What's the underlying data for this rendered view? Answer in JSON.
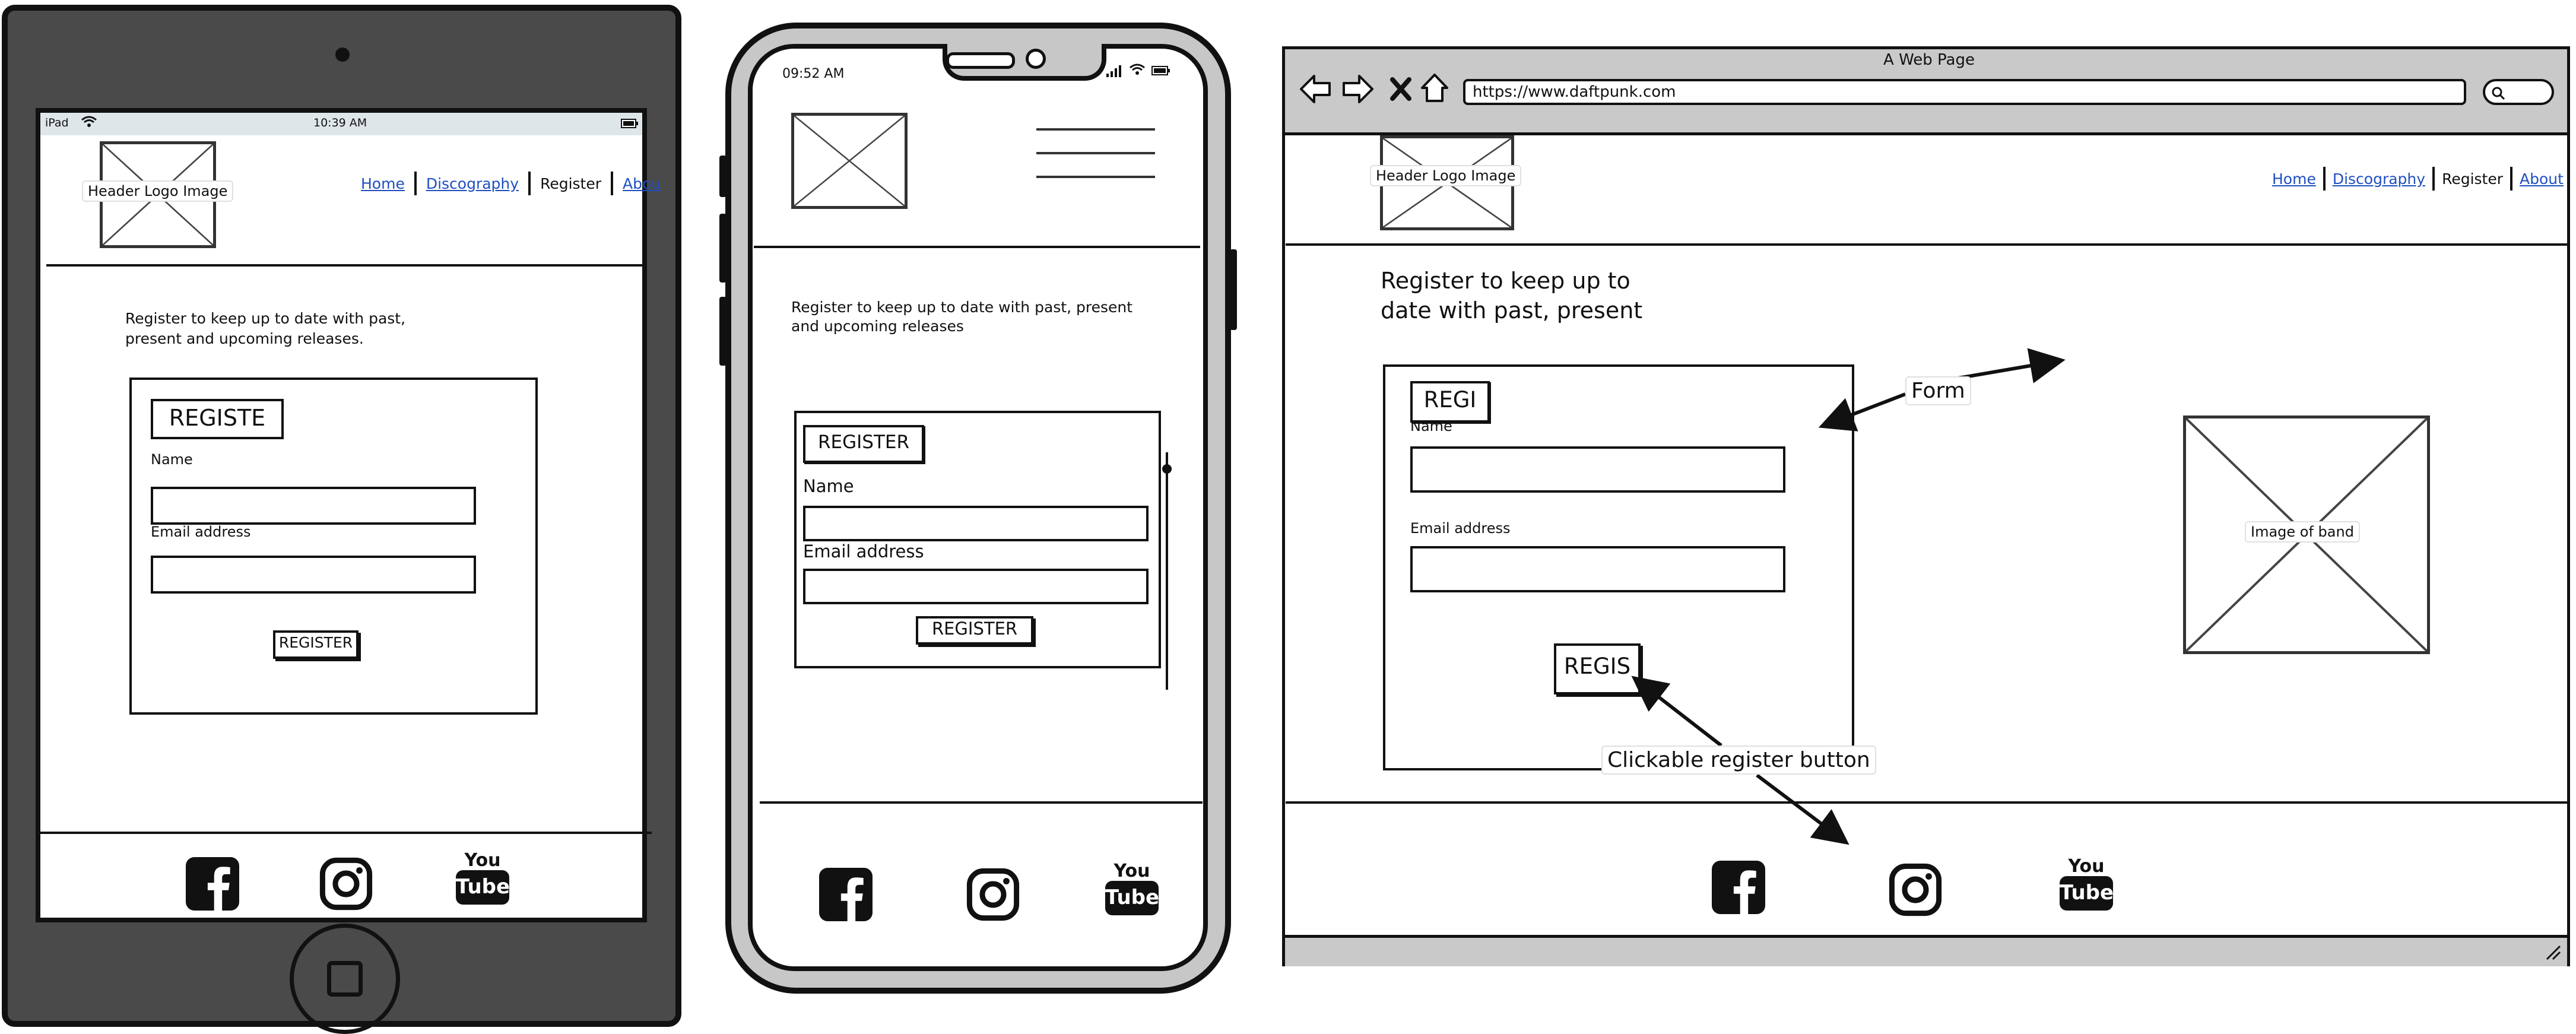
{
  "tablet": {
    "status": {
      "device": "iPad",
      "time": "10:39 AM"
    },
    "logo_label": "Header Logo Image",
    "nav": [
      "Home",
      "Discography",
      "Register",
      "Abou"
    ],
    "intro": [
      "Register to keep up to date with past,",
      "present and upcoming releases."
    ],
    "form_title": "REGISTE",
    "name_label": "Name",
    "email_label": "Email address",
    "submit": "REGISTER"
  },
  "phone": {
    "status": {
      "time": "09:52 AM"
    },
    "intro": [
      "Register to keep up to date with past, present",
      "and upcoming releases"
    ],
    "form_title": "REGISTER",
    "name_label": "Name",
    "email_label": "Email address",
    "submit": "REGISTER"
  },
  "desktop": {
    "window_title": "A Web Page",
    "url": "https://www.daftpunk.com",
    "logo_label": "Header Logo Image",
    "nav": [
      "Home",
      "Discography",
      "Register",
      "About"
    ],
    "intro": [
      "Register to keep up to",
      "date with past, present"
    ],
    "form_title": "REGI",
    "name_label": "Name",
    "email_label": "Email address",
    "submit": "REGIS",
    "band_image_label": "Image of band",
    "annotation_form": "Form",
    "annotation_button": "Clickable register button"
  },
  "social": {
    "icons": [
      "facebook-icon",
      "instagram-icon",
      "youtube-icon"
    ],
    "youtube_text": [
      "You",
      "Tube"
    ]
  }
}
